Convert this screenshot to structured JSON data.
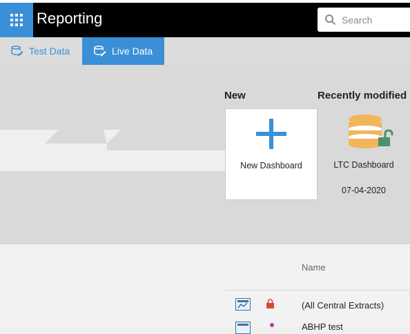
{
  "header": {
    "title": "Reporting",
    "search_placeholder": "Search"
  },
  "tabs": [
    {
      "label": "Test Data",
      "active": false
    },
    {
      "label": "Live Data",
      "active": true
    }
  ],
  "sections": {
    "new_label": "New",
    "recent_label": "Recently modified"
  },
  "cards": {
    "new": {
      "label": "New Dashboard"
    },
    "recent": [
      {
        "label": "LTC Dashboard",
        "date": "07-04-2020",
        "locked": true
      }
    ]
  },
  "table": {
    "columns": [
      "Name"
    ],
    "rows": [
      {
        "name": "(All Central Extracts)",
        "status_icon": "lock-icon"
      },
      {
        "name": "ABHP test",
        "status_icon": "person-icon"
      }
    ]
  },
  "colors": {
    "accent": "#3b8fd6",
    "topbar": "#000000",
    "database_gold": "#f2b55a",
    "lock_green": "#4f8f6a",
    "lock_red": "#d44a3a"
  }
}
